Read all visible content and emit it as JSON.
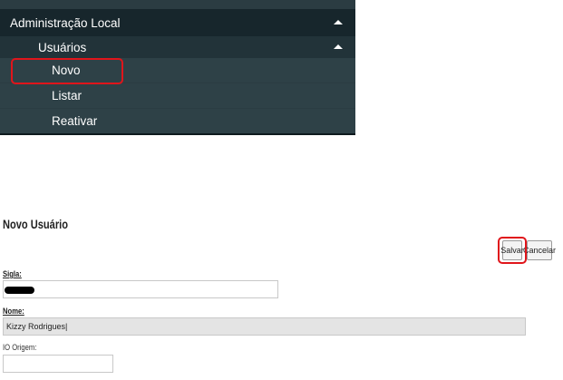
{
  "menu": {
    "section": "Administração Local",
    "subsection": "Usuários",
    "items": [
      {
        "label": "Novo"
      },
      {
        "label": "Listar"
      },
      {
        "label": "Reativar"
      }
    ]
  },
  "form": {
    "title": "Novo Usuário",
    "buttons": {
      "save": "Salvar",
      "cancel": "Cancelar"
    },
    "fields": {
      "sigla": {
        "label": "Sigla:",
        "value": ""
      },
      "nome": {
        "label": "Nome:",
        "value": "Kizzy Rodrigues|"
      },
      "io_origem": {
        "label": "IO Origem:",
        "value": ""
      }
    }
  },
  "colors": {
    "menu_background": "#2b3c42",
    "menu_header": "#17262c",
    "highlight": "#e0151b"
  }
}
